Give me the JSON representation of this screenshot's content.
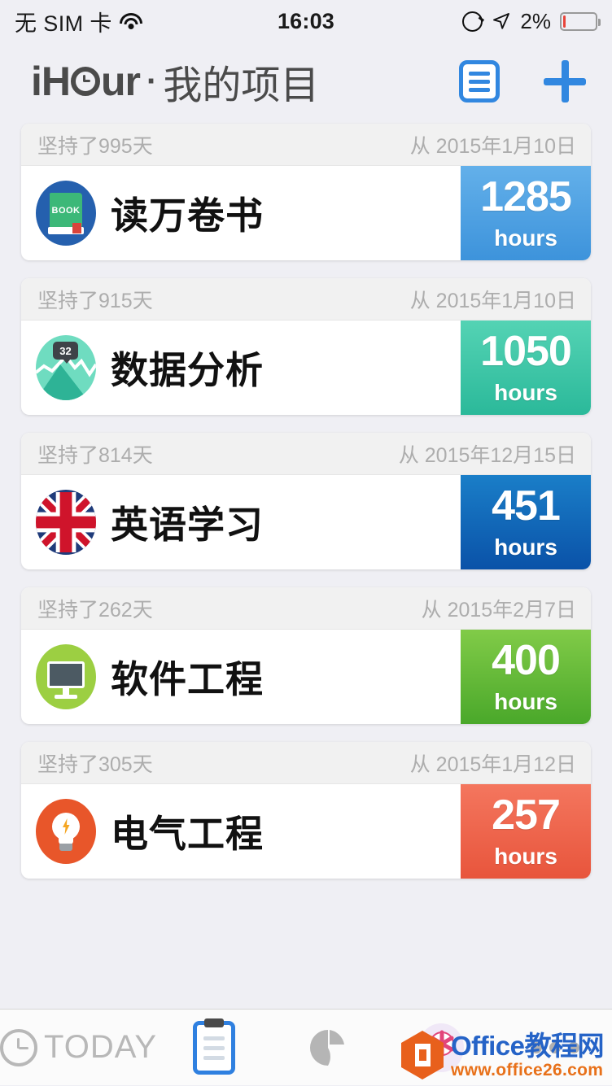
{
  "statusbar": {
    "carrier": "无 SIM 卡",
    "wifi_icon": "wifi-icon",
    "time": "16:03",
    "rotation_lock_icon": "rotation-lock-icon",
    "location_icon": "location-arrow-icon",
    "battery_percent": "2%",
    "battery_icon": "battery-icon"
  },
  "header": {
    "app_name_prefix": "i",
    "app_name_suffix": "ur",
    "separator": "·",
    "page_title": "我的项目",
    "list_button_icon": "list-icon",
    "add_button_icon": "plus-icon"
  },
  "projects": [
    {
      "streak": "坚持了995天",
      "since": "从 2015年1月10日",
      "name": "读万卷书",
      "hours": "1285",
      "unit": "hours",
      "icon": "book-icon",
      "icon_badge": "BOOK",
      "accent": "#3d93db"
    },
    {
      "streak": "坚持了915天",
      "since": "从 2015年1月10日",
      "name": "数据分析",
      "hours": "1050",
      "unit": "hours",
      "icon": "chart-mountain-icon",
      "icon_badge": "32",
      "accent": "#2bb99a"
    },
    {
      "streak": "坚持了814天",
      "since": "从 2015年12月15日",
      "name": "英语学习",
      "hours": "451",
      "unit": "hours",
      "icon": "uk-flag-icon",
      "icon_badge": "",
      "accent": "#0a52a8"
    },
    {
      "streak": "坚持了262天",
      "since": "从 2015年2月7日",
      "name": "软件工程",
      "hours": "400",
      "unit": "hours",
      "icon": "monitor-icon",
      "icon_badge": "",
      "accent": "#4aa82a"
    },
    {
      "streak": "坚持了305天",
      "since": "从 2015年1月12日",
      "name": "电气工程",
      "hours": "257",
      "unit": "hours",
      "icon": "lightbulb-icon",
      "icon_badge": "",
      "accent": "#e8553c"
    }
  ],
  "tabbar": {
    "today_label": "TODAY",
    "today_icon": "clock-icon",
    "projects_icon": "clipboard-icon",
    "stats_icon": "pie-chart-icon",
    "rewards_icon": "lollipop-icon",
    "more_icon": "more-dots-icon"
  },
  "watermark": {
    "logo_icon": "office-hexagon-icon",
    "site_name": "Office教程网",
    "site_url": "www.office26.com"
  }
}
